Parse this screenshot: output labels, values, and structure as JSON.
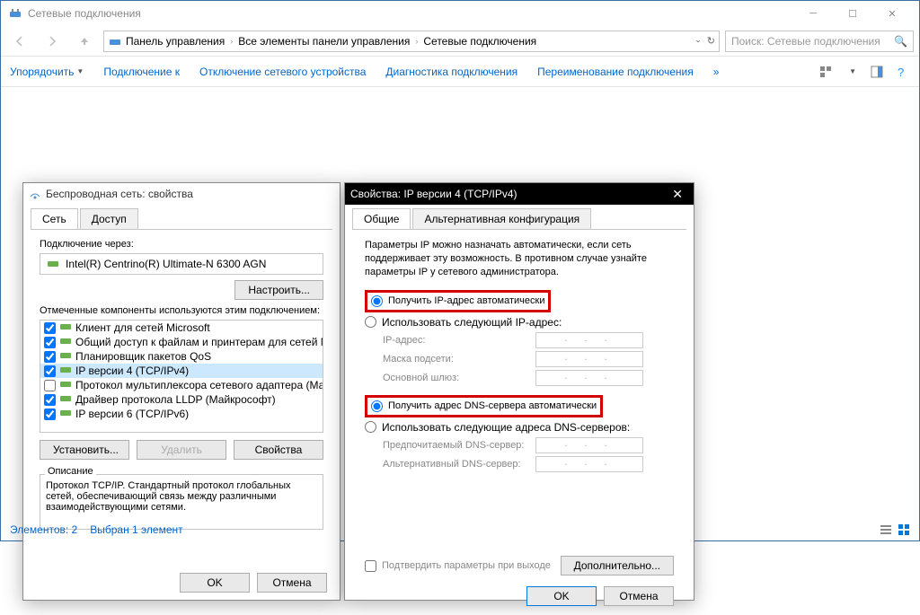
{
  "window": {
    "title": "Сетевые подключения",
    "breadcrumb": [
      "Панель управления",
      "Все элементы панели управления",
      "Сетевые подключения"
    ],
    "search_placeholder": "Поиск: Сетевые подключения"
  },
  "toolbar": {
    "organize": "Упорядочить",
    "connect": "Подключение к",
    "disable": "Отключение сетевого устройства",
    "diagnose": "Диагностика подключения",
    "rename": "Переименование подключения",
    "more": "»"
  },
  "statusbar": {
    "elements": "Элементов: 2",
    "selected": "Выбран 1 элемент"
  },
  "dlg_wireless": {
    "title": "Беспроводная сеть: свойства",
    "tab_network": "Сеть",
    "tab_access": "Доступ",
    "connect_via": "Подключение через:",
    "adapter": "Intel(R) Centrino(R) Ultimate-N 6300 AGN",
    "configure": "Настроить...",
    "components_label": "Отмеченные компоненты используются этим подключением:",
    "components": [
      {
        "checked": true,
        "label": "Клиент для сетей Microsoft"
      },
      {
        "checked": true,
        "label": "Общий доступ к файлам и принтерам для сетей Mi"
      },
      {
        "checked": true,
        "label": "Планировщик пакетов QoS"
      },
      {
        "checked": true,
        "label": "IP версии 4 (TCP/IPv4)",
        "selected": true
      },
      {
        "checked": false,
        "label": "Протокол мультиплексора сетевого адаптера (Май"
      },
      {
        "checked": true,
        "label": "Драйвер протокола LLDP (Майкрософт)"
      },
      {
        "checked": true,
        "label": "IP версии 6 (TCP/IPv6)"
      }
    ],
    "install": "Установить...",
    "remove": "Удалить",
    "properties": "Свойства",
    "desc_title": "Описание",
    "desc_text": "Протокол TCP/IP. Стандартный протокол глобальных сетей, обеспечивающий связь между различными взаимодействующими сетями.",
    "ok": "OK",
    "cancel": "Отмена"
  },
  "dlg_ipv4": {
    "title": "Свойства: IP версии 4 (TCP/IPv4)",
    "tab_general": "Общие",
    "tab_alt": "Альтернативная конфигурация",
    "info": "Параметры IP можно назначать автоматически, если сеть поддерживает эту возможность. В противном случае узнайте параметры IP у сетевого администратора.",
    "radio_ip_auto": "Получить IP-адрес автоматически",
    "radio_ip_manual": "Использовать следующий IP-адрес:",
    "ip_address": "IP-адрес:",
    "subnet": "Маска подсети:",
    "gateway": "Основной шлюз:",
    "radio_dns_auto": "Получить адрес DNS-сервера автоматически",
    "radio_dns_manual": "Использовать следующие адреса DNS-серверов:",
    "dns_pref": "Предпочитаемый DNS-сервер:",
    "dns_alt": "Альтернативный DNS-сервер:",
    "confirm_exit": "Подтвердить параметры при выходе",
    "advanced": "Дополнительно...",
    "ok": "OK",
    "cancel": "Отмена",
    "ip_placeholder": ".   .   ."
  }
}
